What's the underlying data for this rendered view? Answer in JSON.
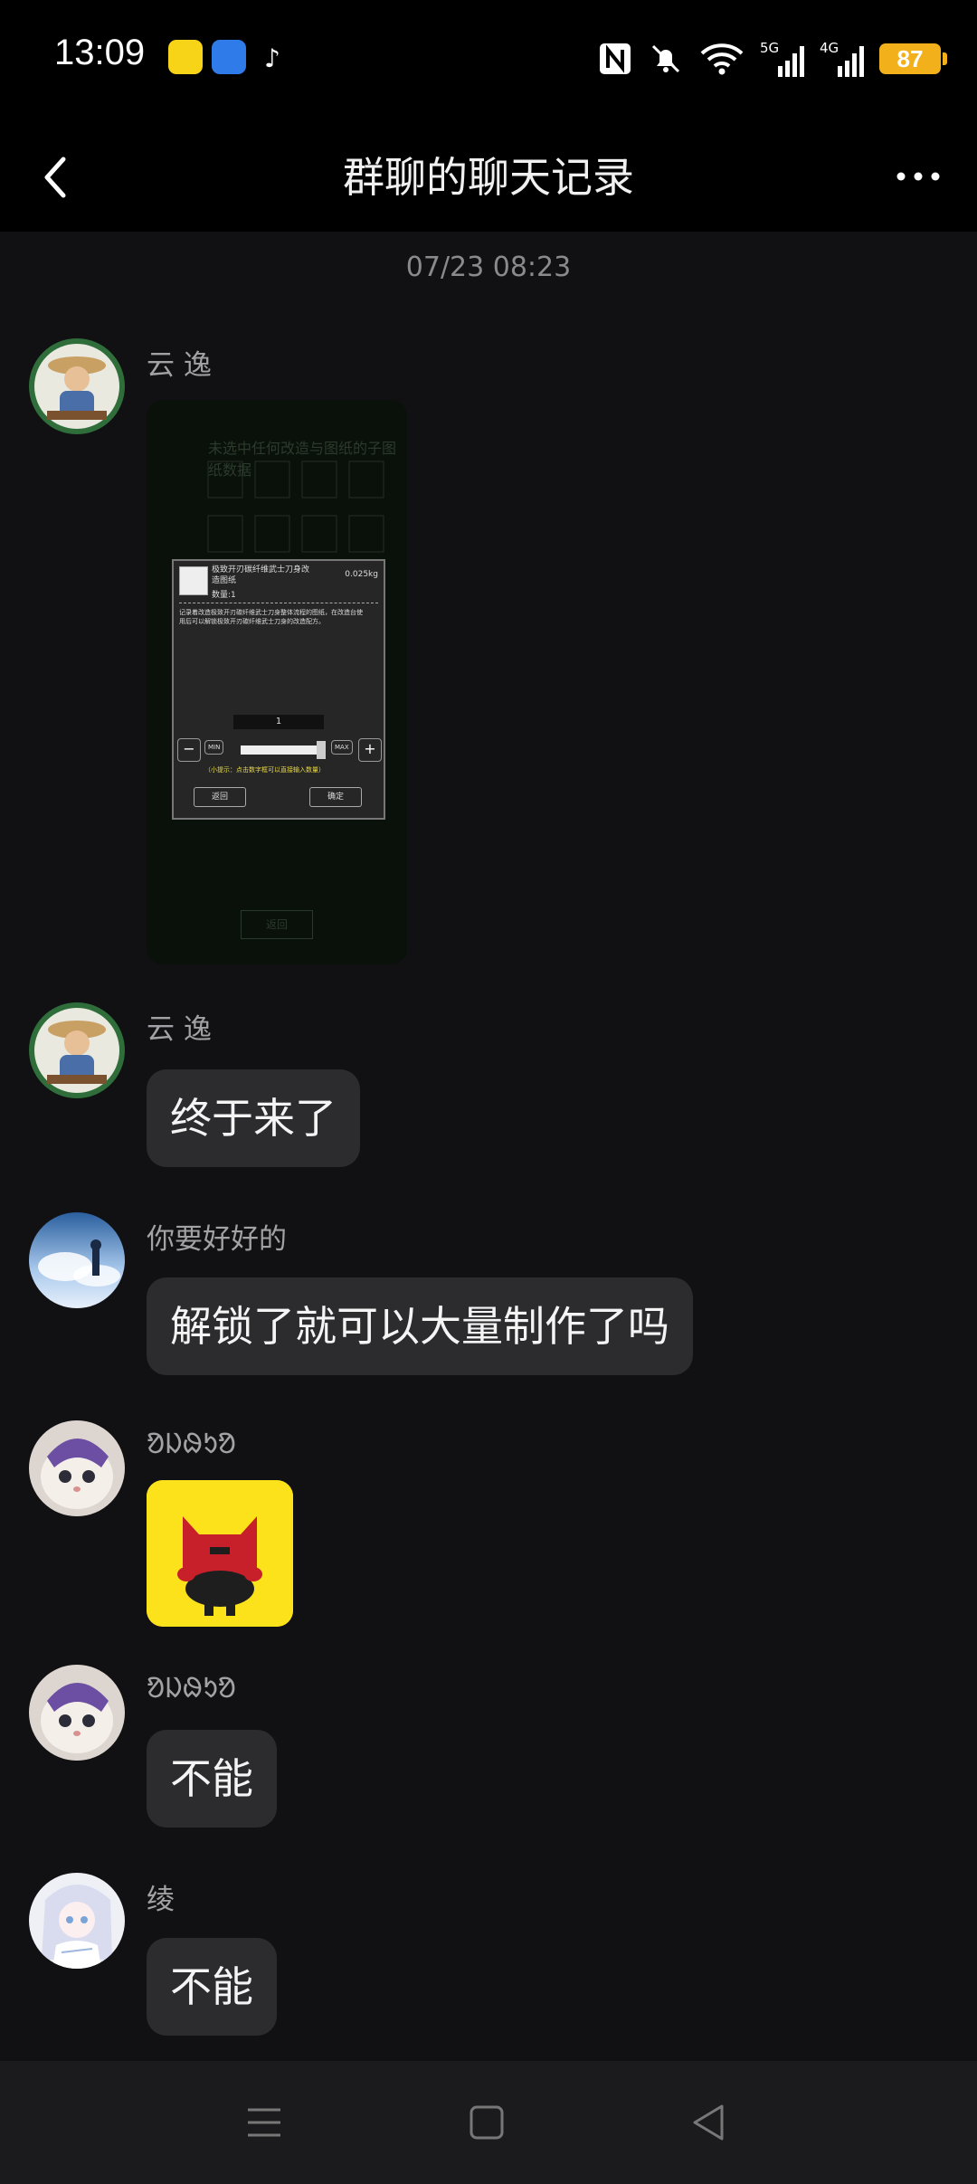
{
  "status_bar": {
    "time": "13:09",
    "network_5g": "5G",
    "network_4g": "4G",
    "battery": "87",
    "icons": [
      "nfc-icon",
      "mute-icon",
      "wifi-icon",
      "signal-5g-icon",
      "signal-4g-icon",
      "battery-icon"
    ]
  },
  "header": {
    "title": "群聊的聊天记录"
  },
  "chat": {
    "timestamp": "07/23 08:23",
    "messages": [
      {
        "sender": "云 逸",
        "type": "image",
        "image_text": {
          "item_name": "极致开刃碳纤维武士刀身改造图纸",
          "weight": "0.025kg",
          "count": "数量:1",
          "description_line1": "记录着改造极致开刃碳纤维武士刀身整体流程的图纸，在改造台使",
          "description_line2": "用后可以解锁极致开刃碳纤维武士刀身的改造配方。",
          "quantity": "1",
          "min": "MIN",
          "max": "MAX",
          "hint": "（小提示：点击数字框可以直接输入数量）",
          "back": "返回",
          "confirm": "确定",
          "bottom_back": "返回",
          "bg_header": "未选中任何改造与图纸的子图纸数据"
        }
      },
      {
        "sender": "云 逸",
        "type": "text",
        "text": "终于来了"
      },
      {
        "sender": "你要好好的",
        "type": "text",
        "text": "解锁了就可以大量制作了吗"
      },
      {
        "sender": "ᱚᱡᱷᱩᱚ",
        "type": "sticker"
      },
      {
        "sender": "ᱚᱡᱷᱩᱚ",
        "type": "text",
        "text": "不能"
      },
      {
        "sender": "绫",
        "type": "text",
        "text": "不能"
      }
    ]
  },
  "nav_bar": {
    "icons": [
      "menu-icon",
      "home-icon",
      "back-icon"
    ]
  },
  "colors": {
    "background": "#111113",
    "bubble": "#2c2c2e",
    "battery": "#f2b11b",
    "sticker_bg": "#fbe21a"
  }
}
